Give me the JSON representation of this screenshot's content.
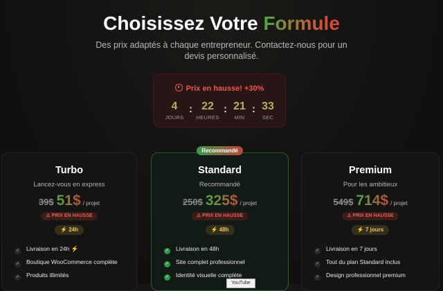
{
  "header": {
    "title_main": "Choisissez Votre",
    "title_accent": "Formule",
    "subtitle": "Des prix adaptés à chaque entrepreneur. Contactez-nous pour un devis personnalisé."
  },
  "timer": {
    "heading": "Prix en hausse! +30%",
    "units": [
      {
        "value": "4",
        "label": "JOURS"
      },
      {
        "value": "22",
        "label": "HEURES"
      },
      {
        "value": "21",
        "label": "MIN"
      },
      {
        "value": "33",
        "label": "SEC"
      }
    ],
    "separator": ":"
  },
  "recommended_badge": "Recommandé",
  "plans": [
    {
      "name": "Turbo",
      "tagline": "Lancez-vous en express",
      "old_price": "39$",
      "price": "51$",
      "per": "/ projet",
      "hausse": "PRIX EN HAUSSE",
      "speed": "24h",
      "features": [
        "Livraison en 24h",
        "Boutique WooCommerce complète",
        "Produits illimités"
      ]
    },
    {
      "name": "Standard",
      "tagline": "Recommandé",
      "old_price": "250$",
      "price": "325$",
      "per": "/ projet",
      "hausse": "PRIX EN HAUSSE",
      "speed": "48h",
      "features": [
        "Livraison en 48h",
        "Site complet professionnel",
        "Identité visuelle complète"
      ]
    },
    {
      "name": "Premium",
      "tagline": "Pour les ambitieux",
      "old_price": "549$",
      "price": "714$",
      "per": "/ projet",
      "hausse": "PRIX EN HAUSSE",
      "speed": "7 jours",
      "features": [
        "Livraison en 7 jours",
        "Tout du plan Standard inclus",
        "Design professionnel premium"
      ]
    }
  ],
  "tooltip": "YouTube",
  "icons": {
    "clock": "clock-icon",
    "warning": "warning-icon",
    "bolt": "bolt-icon",
    "check": "check-icon"
  },
  "colors": {
    "accent_green": "#4aa84a",
    "accent_red": "#d9443a",
    "warning_red": "#e55a4a",
    "gold": "#e8c45a"
  }
}
